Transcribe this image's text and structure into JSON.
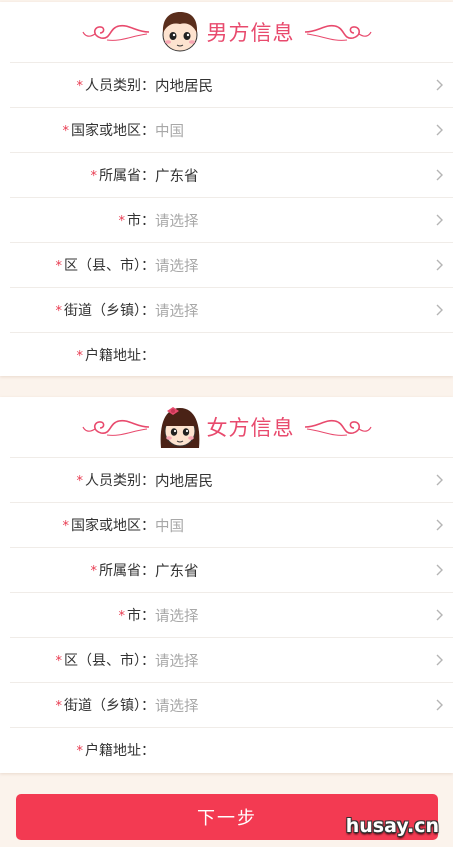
{
  "male_section": {
    "title": "男方信息",
    "rows": [
      {
        "label": "人员类别：",
        "value": "内地居民",
        "placeholder": false,
        "chevron": true
      },
      {
        "label": "国家或地区：",
        "value": "中国",
        "placeholder": true,
        "chevron": true
      },
      {
        "label": "所属省：",
        "value": "广东省",
        "placeholder": false,
        "chevron": true
      },
      {
        "label": "市：",
        "value": "请选择",
        "placeholder": true,
        "chevron": true
      },
      {
        "label": "区（县、市）：",
        "value": "请选择",
        "placeholder": true,
        "chevron": true
      },
      {
        "label": "街道（乡镇）：",
        "value": "请选择",
        "placeholder": true,
        "chevron": true
      },
      {
        "label": "户籍地址：",
        "value": "",
        "placeholder": false,
        "chevron": false
      }
    ]
  },
  "female_section": {
    "title": "女方信息",
    "rows": [
      {
        "label": "人员类别：",
        "value": "内地居民",
        "placeholder": false,
        "chevron": true
      },
      {
        "label": "国家或地区：",
        "value": "中国",
        "placeholder": true,
        "chevron": true
      },
      {
        "label": "所属省：",
        "value": "广东省",
        "placeholder": false,
        "chevron": true
      },
      {
        "label": "市：",
        "value": "请选择",
        "placeholder": true,
        "chevron": true
      },
      {
        "label": "区（县、市）：",
        "value": "请选择",
        "placeholder": true,
        "chevron": true
      },
      {
        "label": "街道（乡镇）：",
        "value": "请选择",
        "placeholder": true,
        "chevron": true
      },
      {
        "label": "户籍地址：",
        "value": "",
        "placeholder": false,
        "chevron": false
      }
    ]
  },
  "required_mark": "*",
  "next_button_label": "下一步",
  "watermark": "husay.cn",
  "colors": {
    "accent": "#e84a6d",
    "button": "#f33a52",
    "placeholder": "#a8a8a8",
    "background": "#fbf3ec"
  },
  "icons": {
    "row_arrow": "chevron-right-icon",
    "male_avatar": "boy-face-icon",
    "female_avatar": "girl-face-icon",
    "ornament": "swirl-ornament-icon"
  }
}
